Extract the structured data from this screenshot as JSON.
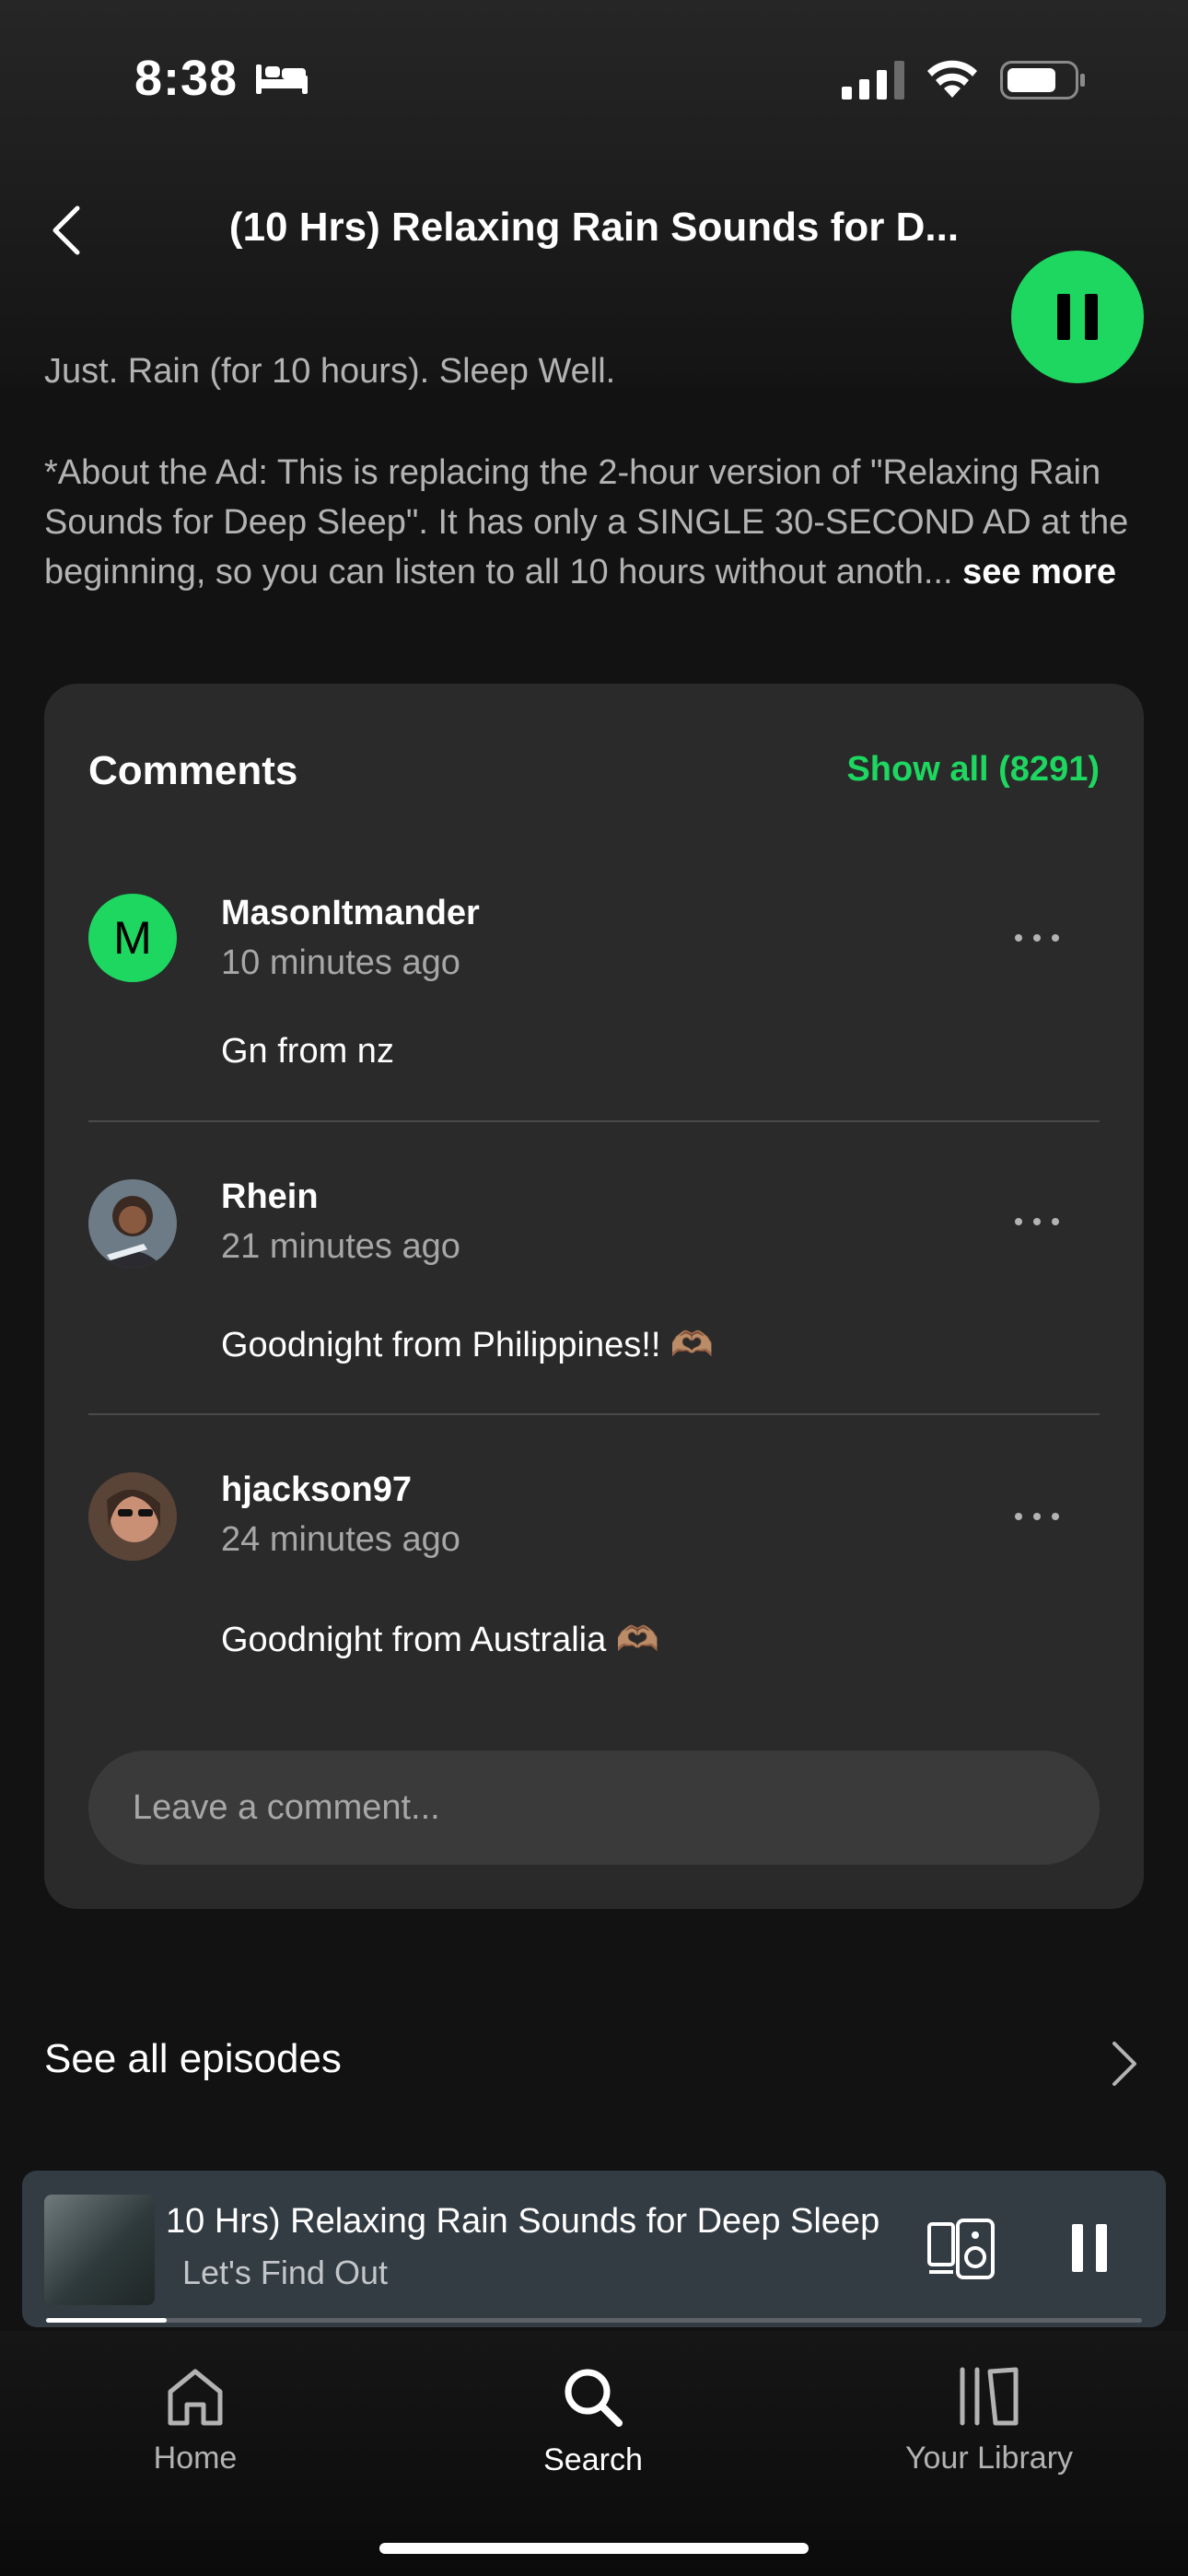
{
  "status_bar": {
    "time": "8:38"
  },
  "header": {
    "title": "(10 Hrs) Relaxing Rain Sounds for D..."
  },
  "description": {
    "line1": "Just. Rain (for 10 hours). Sleep Well.",
    "para": "*About the Ad: This is replacing the 2-hour version of \"Relaxing Rain Sounds for Deep Sleep\". It has only a SINGLE 30-SECOND AD at the beginning, so you can listen to all 10 hours without anoth...",
    "see_more": "see more"
  },
  "comments": {
    "title": "Comments",
    "show_all": "Show all (8291)",
    "items": [
      {
        "initial": "M",
        "name": "MasonItmander",
        "time": "10 minutes ago",
        "text": "Gn from nz"
      },
      {
        "name": "Rhein",
        "time": "21 minutes ago",
        "text": "Goodnight from Philippines!! 🫶🏽"
      },
      {
        "name": "hjackson97",
        "time": "24 minutes ago",
        "text": "Goodnight from Australia 🫶🏽"
      }
    ],
    "input_placeholder": "Leave a comment..."
  },
  "see_all_episodes": "See all episodes",
  "mini_player": {
    "title": "10 Hrs) Relaxing Rain Sounds for Deep Sleep",
    "subtitle": "Let's Find Out",
    "progress": 0.11
  },
  "nav": {
    "home": "Home",
    "search": "Search",
    "library": "Your Library",
    "active": "search"
  },
  "colors": {
    "accent": "#1ed760",
    "background": "#121212",
    "card": "#2a2a2a"
  }
}
